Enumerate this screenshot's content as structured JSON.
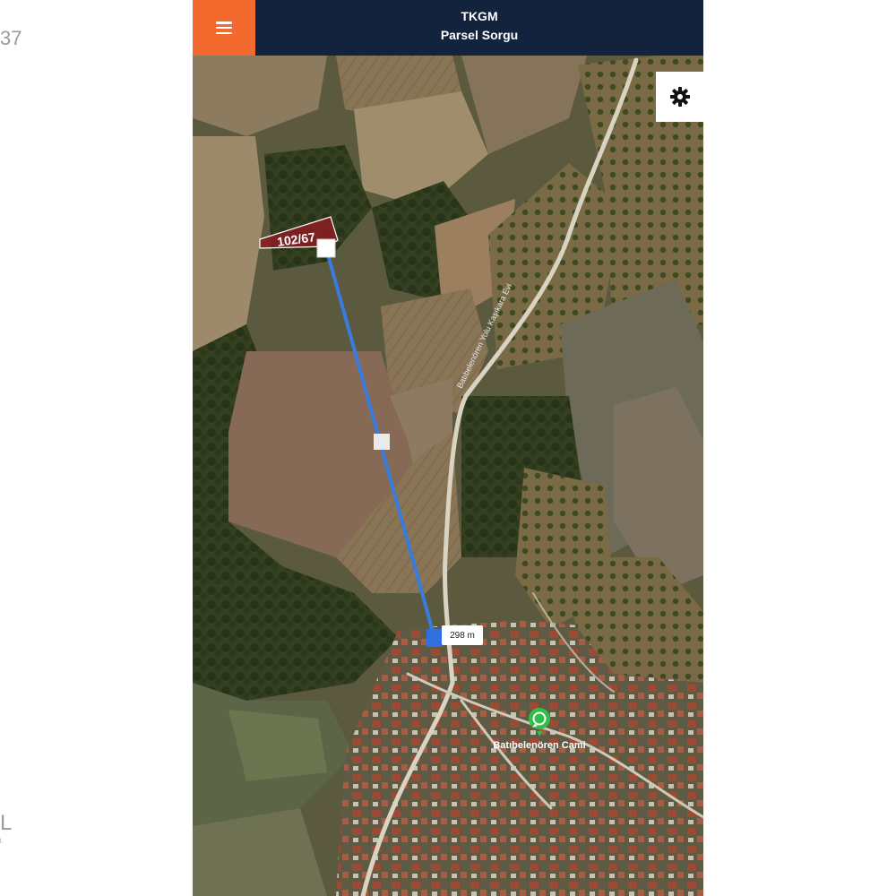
{
  "page_edge": {
    "top_text": "37",
    "bottom_text": "L",
    "bottom_small_text": "l."
  },
  "header": {
    "title": "TKGM",
    "subtitle": "Parsel Sorgu",
    "menu_icon": "hamburger-icon",
    "accent_color": "#f26a2e",
    "bar_color": "#14233d"
  },
  "map": {
    "type": "satellite",
    "parcel_label": "102/67",
    "parcel_color": "#8b1c22",
    "measure_line_color": "#3a7be0",
    "distance_label": "298 m",
    "road_label": "Batıbelenören Yolu Kaşıkara Evi",
    "place_label": "Batıbelenören Cami",
    "place_icon": "whatsapp-icon",
    "settings_icon": "gear-icon"
  }
}
